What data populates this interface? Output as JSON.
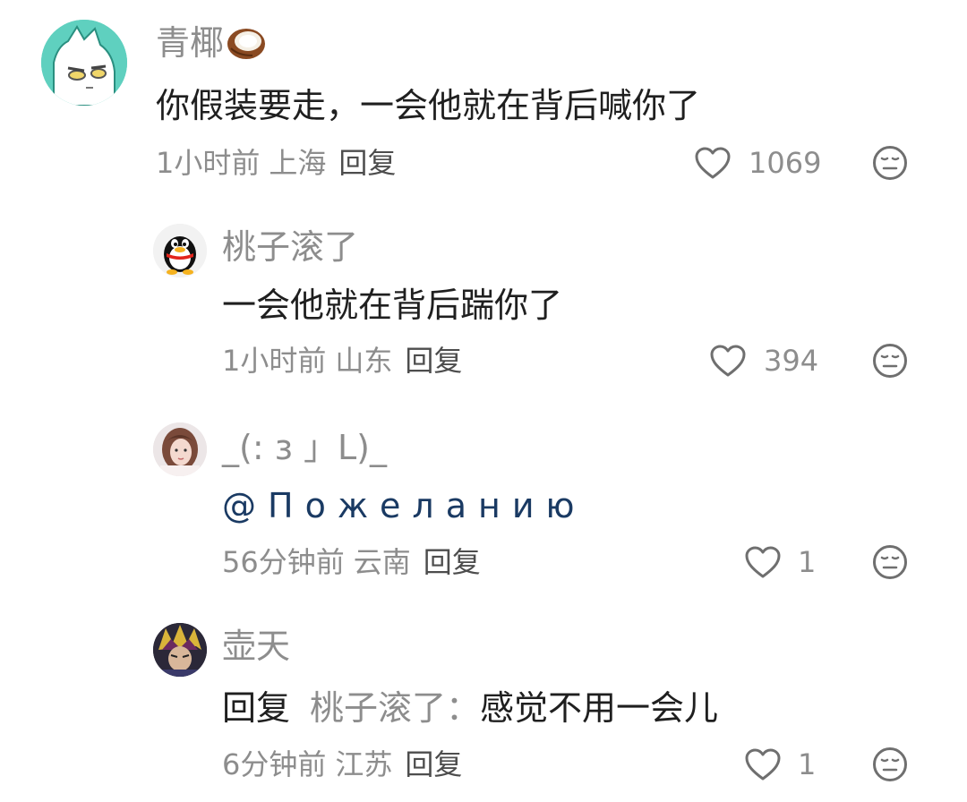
{
  "comments": [
    {
      "username": "青椰",
      "username_emoji": "coconut-emoji",
      "avatar": "white-cat-avatar",
      "content": "你假装要走，一会他就在背后喊你了",
      "time": "1小时前",
      "location": "上海",
      "reply_label": "回复",
      "likes": "1069"
    },
    {
      "username": "桃子滚了",
      "avatar": "penguin-avatar",
      "content": "一会他就在背后踹你了",
      "time": "1小时前",
      "location": "山东",
      "reply_label": "回复",
      "likes": "394"
    },
    {
      "username": "_(: з 」L)_",
      "avatar": "girl-photo-avatar",
      "mention": "@Пожеланию",
      "time": "56分钟前",
      "location": "云南",
      "reply_label": "回复",
      "likes": "1"
    },
    {
      "username": "壶天",
      "avatar": "anime-character-avatar",
      "reply_prefix": "回复",
      "reply_target": "桃子滚了：",
      "content": "感觉不用一会儿",
      "time": "6分钟前",
      "location": "江苏",
      "reply_label": "回复",
      "likes": "1"
    }
  ],
  "colors": {
    "username": "#8d8d8d",
    "content": "#1f1f1f",
    "meta": "#8d8d8d",
    "mention": "#1a3a63"
  },
  "icons": {
    "like": "heart-outline-icon",
    "dislike": "meh-face-icon"
  }
}
